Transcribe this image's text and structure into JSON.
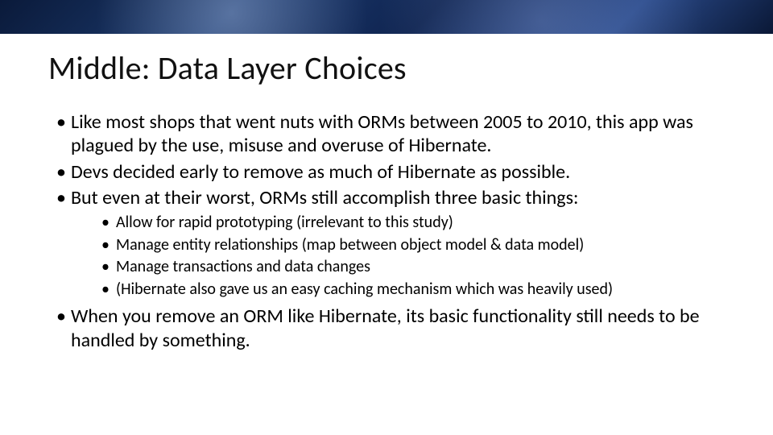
{
  "title": "Middle: Data Layer Choices",
  "bullets": [
    "Like most shops that went nuts with ORMs between 2005 to 2010, this app was plagued by the use, misuse and overuse of Hibernate.",
    "Devs decided early to remove as much of Hibernate as possible.",
    "But even at their worst, ORMs still accomplish three basic things:",
    "When you remove an ORM like Hibernate, its basic functionality still needs to be handled by something."
  ],
  "sub_bullets": [
    "Allow for rapid prototyping (irrelevant to this study)",
    "Manage entity relationships (map between object model & data model)",
    "Manage transactions and data changes",
    "(Hibernate also gave us an easy caching mechanism which was heavily used)"
  ]
}
